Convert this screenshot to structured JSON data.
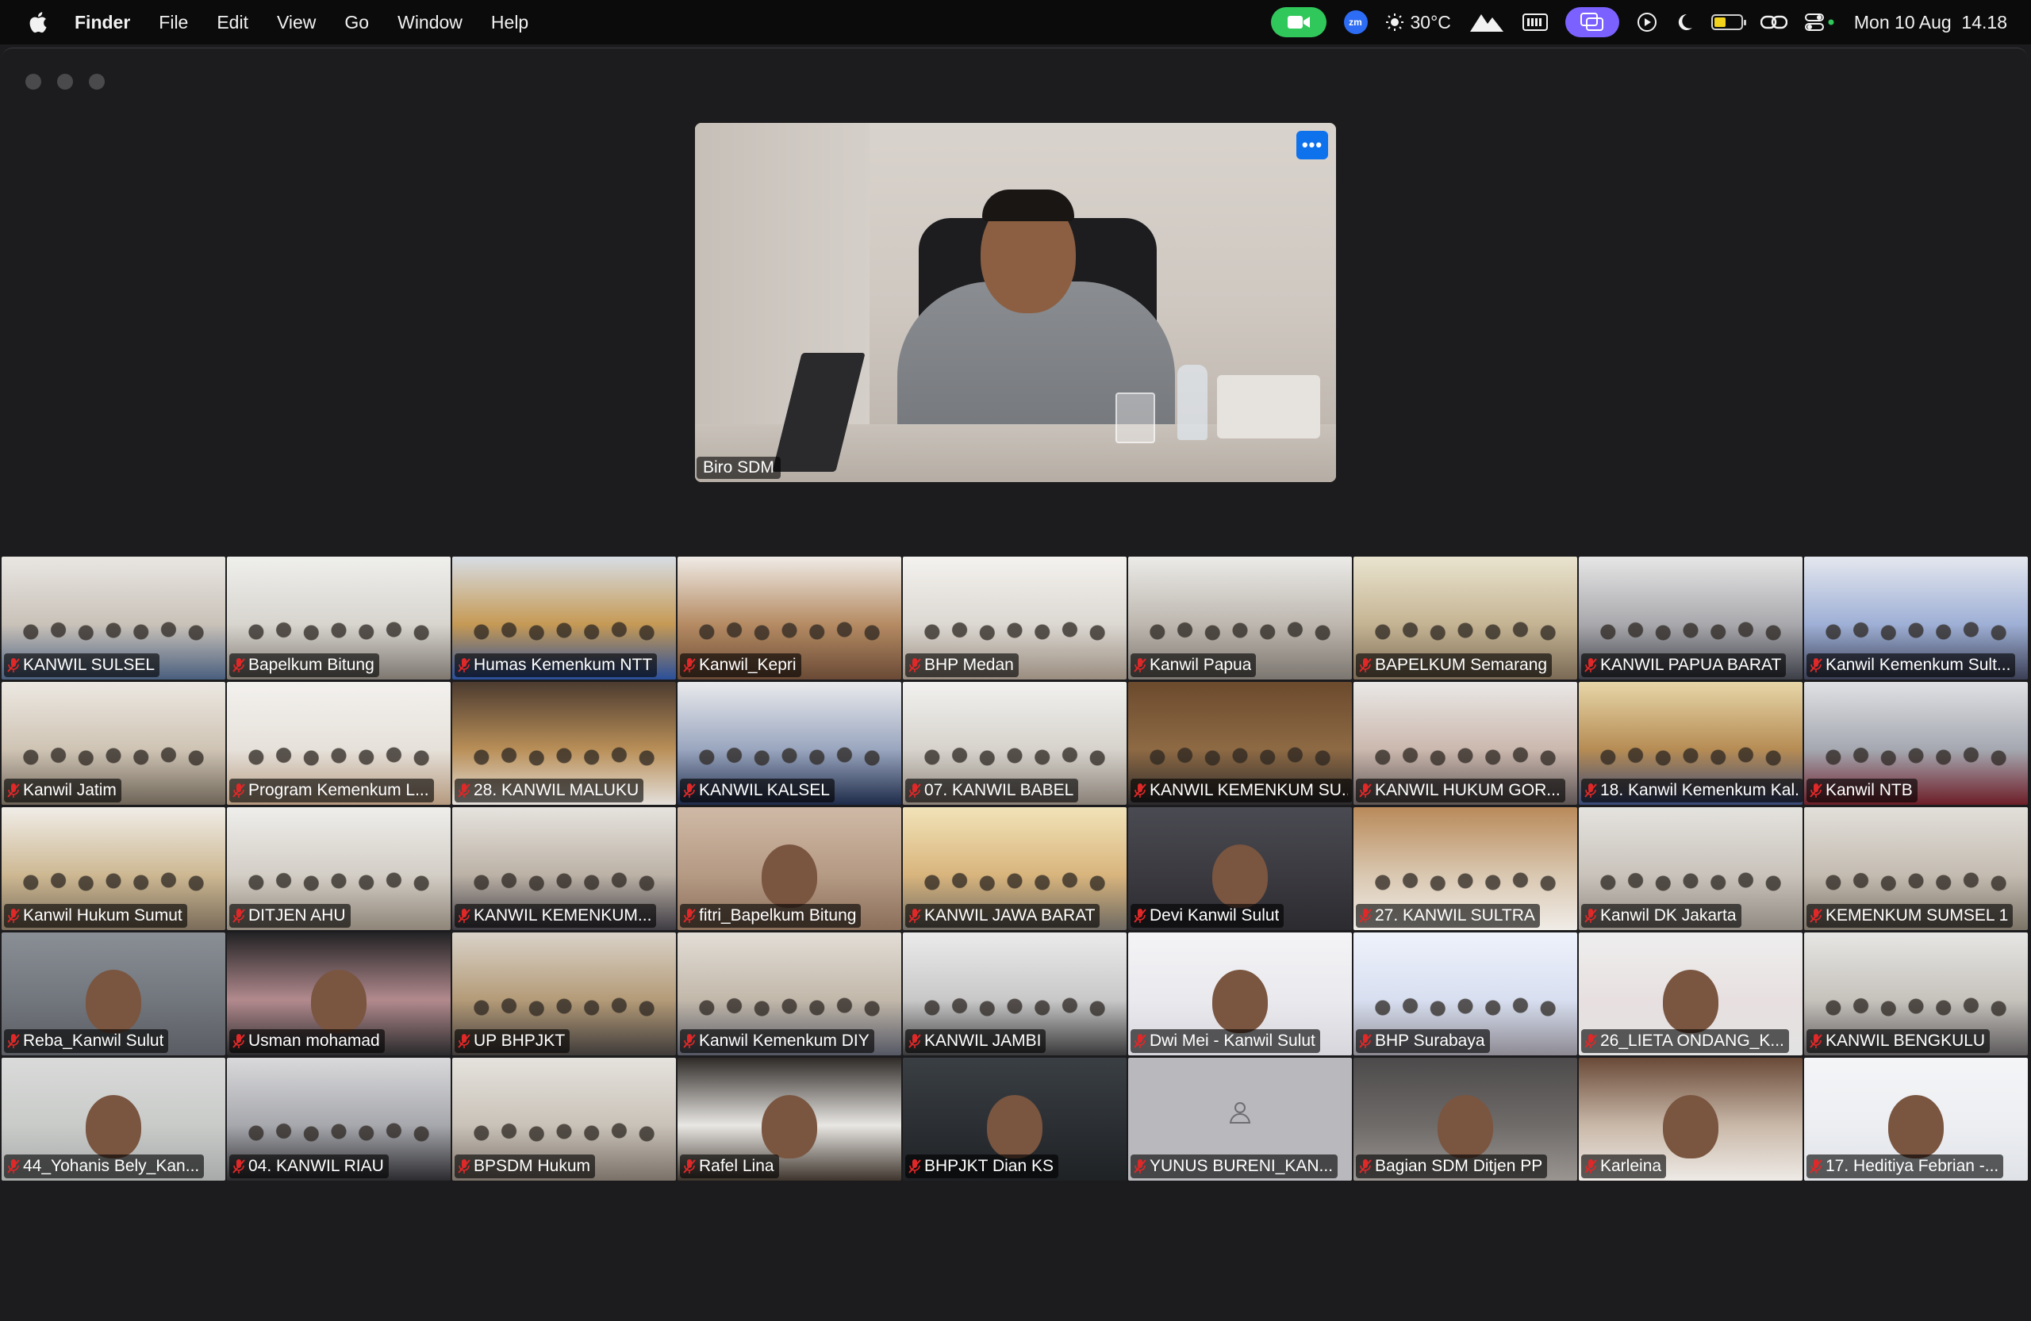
{
  "menubar": {
    "app": "Finder",
    "items": [
      "File",
      "Edit",
      "View",
      "Go",
      "Window",
      "Help"
    ],
    "weather": "30°C",
    "zoom_badge": "zm",
    "datetime": "Mon 10 Aug  14.18"
  },
  "speaker": {
    "name": "Biro SDM",
    "more_label": "•••"
  },
  "participants": [
    {
      "name": "KANWIL SULSEL",
      "kind": "room",
      "c": [
        "#e9e6e2",
        "#c9c2b9",
        "#4a5f7e"
      ]
    },
    {
      "name": "Bapelkum Bitung",
      "kind": "room",
      "c": [
        "#efefec",
        "#d8d5cf",
        "#7d7770"
      ]
    },
    {
      "name": "Humas Kemenkum NTT",
      "kind": "room",
      "c": [
        "#d7dde4",
        "#c69a55",
        "#2a4f9a"
      ]
    },
    {
      "name": "Kanwil_Kepri",
      "kind": "room",
      "c": [
        "#efebe6",
        "#b58b63",
        "#6a4a36"
      ]
    },
    {
      "name": "BHP Medan",
      "kind": "room",
      "c": [
        "#f4f2ef",
        "#dcd8d2",
        "#9a8d80"
      ]
    },
    {
      "name": "Kanwil Papua",
      "kind": "room",
      "c": [
        "#ecebe8",
        "#bdb7af",
        "#7c7670"
      ]
    },
    {
      "name": "BAPELKUM Semarang",
      "kind": "room",
      "c": [
        "#e9e4cf",
        "#c5b493",
        "#7a6a55"
      ]
    },
    {
      "name": "KANWIL PAPUA BARAT",
      "kind": "room",
      "c": [
        "#e6e6e6",
        "#a9a9ad",
        "#3d3f48"
      ]
    },
    {
      "name": "Kanwil Kemenkum Sult...",
      "kind": "room",
      "c": [
        "#e4e7ee",
        "#9fb0d6",
        "#3b3f55"
      ]
    },
    {
      "name": "Kanwil Jatim",
      "kind": "room",
      "c": [
        "#ece8e2",
        "#cfc4b4",
        "#6e6457"
      ]
    },
    {
      "name": "Program Kemenkum L...",
      "kind": "room",
      "c": [
        "#f3f1ee",
        "#e6e1da",
        "#b59a7f"
      ]
    },
    {
      "name": "28. KANWIL MALUKU",
      "kind": "room",
      "c": [
        "#4c3b2f",
        "#b98f58",
        "#e3dfda"
      ]
    },
    {
      "name": "KANWIL KALSEL",
      "kind": "room",
      "c": [
        "#e9eaec",
        "#9aa6bf",
        "#1f2c4a"
      ]
    },
    {
      "name": "07. KANWIL BABEL",
      "kind": "room",
      "c": [
        "#f1f1ef",
        "#d7d3cc",
        "#8a8178"
      ]
    },
    {
      "name": "KANWIL KEMENKUM SU...",
      "kind": "room",
      "c": [
        "#6b4a2d",
        "#8e6a44",
        "#2c2a2c"
      ]
    },
    {
      "name": "KANWIL HUKUM GOR...",
      "kind": "room",
      "c": [
        "#eae8e6",
        "#cbb8ae",
        "#5d5454"
      ]
    },
    {
      "name": "18. Kanwil Kemenkum Kal...",
      "kind": "room",
      "c": [
        "#e7d6a8",
        "#b68c54",
        "#3a4a78"
      ]
    },
    {
      "name": "Kanwil NTB",
      "kind": "room",
      "c": [
        "#e0e1e4",
        "#a5a8b1",
        "#6d1e28"
      ]
    },
    {
      "name": "Kanwil Hukum Sumut",
      "kind": "room",
      "c": [
        "#f0ede8",
        "#cdb892",
        "#7a6c5a"
      ]
    },
    {
      "name": "DITJEN AHU",
      "kind": "room",
      "c": [
        "#efeeeb",
        "#d3cec6",
        "#8f8579"
      ]
    },
    {
      "name": "KANWIL KEMENKUM...",
      "kind": "room",
      "c": [
        "#e6e3de",
        "#bcb2a6",
        "#3f3c44"
      ]
    },
    {
      "name": "fitri_Bapelkum Bitung",
      "kind": "portrait",
      "c": [
        "#cfb9a6",
        "#b59a84",
        "#8a6e5a"
      ]
    },
    {
      "name": "KANWIL JAWA BARAT",
      "kind": "room",
      "c": [
        "#f1e3b8",
        "#d9b57d",
        "#6f6a63"
      ]
    },
    {
      "name": "Devi Kanwil Sulut",
      "kind": "portrait",
      "c": [
        "#4a4a52",
        "#3b3a40",
        "#2c2b30"
      ]
    },
    {
      "name": "27. KANWIL SULTRA",
      "kind": "room",
      "c": [
        "#b98a5a",
        "#d9c7b0",
        "#f0ece7"
      ]
    },
    {
      "name": "Kanwil DK Jakarta",
      "kind": "room",
      "c": [
        "#e5e3df",
        "#c9c3bb",
        "#918a82"
      ]
    },
    {
      "name": "KEMENKUM SUMSEL 1",
      "kind": "room",
      "c": [
        "#e2dfda",
        "#c4bcb1",
        "#7c7367"
      ]
    },
    {
      "name": "Reba_Kanwil Sulut",
      "kind": "portrait",
      "c": [
        "#8a8e95",
        "#72767d",
        "#5a5d63"
      ]
    },
    {
      "name": "Usman mohamad",
      "kind": "portrait",
      "c": [
        "#222224",
        "#b28a8e",
        "#2a2a2c"
      ]
    },
    {
      "name": "UP BHPJKT",
      "kind": "room",
      "c": [
        "#d9d2c8",
        "#b49b78",
        "#3f3b3a"
      ]
    },
    {
      "name": "Kanwil Kemenkum DIY",
      "kind": "room",
      "c": [
        "#e2ddd6",
        "#c2b8aa",
        "#555865"
      ]
    },
    {
      "name": "KANWIL JAMBI",
      "kind": "room",
      "c": [
        "#ebebeb",
        "#c8c8c8",
        "#3a3a3c"
      ]
    },
    {
      "name": "Dwi Mei - Kanwil Sulut",
      "kind": "portrait",
      "c": [
        "#f4f4f6",
        "#e9e9ee",
        "#d6d6dc"
      ]
    },
    {
      "name": "BHP Surabaya",
      "kind": "room",
      "c": [
        "#eef2fb",
        "#d8dff0",
        "#8d8a93"
      ]
    },
    {
      "name": "26_LIETA ONDANG_K...",
      "kind": "portrait",
      "c": [
        "#eeeeee",
        "#e8e0e0",
        "#e2e2e2"
      ]
    },
    {
      "name": "KANWIL BENGKULU",
      "kind": "room",
      "c": [
        "#e6e6e4",
        "#c6c2bc",
        "#5e5b5d"
      ]
    },
    {
      "name": "44_Yohanis Bely_Kan...",
      "kind": "portrait",
      "c": [
        "#d9dad9",
        "#c9cbc9",
        "#a7aaa9"
      ]
    },
    {
      "name": "04. KANWIL RIAU",
      "kind": "room",
      "c": [
        "#d9d9db",
        "#a7a8ad",
        "#2c2c30"
      ]
    },
    {
      "name": "BPSDM Hukum",
      "kind": "room",
      "c": [
        "#e5e2dd",
        "#c9c2b8",
        "#7a7168"
      ]
    },
    {
      "name": "Rafel Lina",
      "kind": "portrait",
      "c": [
        "#2f2b28",
        "#e9e7e3",
        "#3e352d"
      ]
    },
    {
      "name": "BHPJKT Dian KS",
      "kind": "portrait",
      "c": [
        "#3a3f44",
        "#2b2f33",
        "#1f2225"
      ]
    },
    {
      "name": "YUNUS BURENI_KAN...",
      "kind": "avatar",
      "c": [
        "#b9b9bd",
        "#b9b9bd",
        "#b9b9bd"
      ]
    },
    {
      "name": "Bagian SDM Ditjen PP",
      "kind": "portrait",
      "c": [
        "#4d4a4b",
        "#6f6b69",
        "#9a9591"
      ]
    },
    {
      "name": "Karleina",
      "kind": "portrait",
      "c": [
        "#6a4a38",
        "#c9b8a8",
        "#eeeae6"
      ]
    },
    {
      "name": "17. Heditiya Febrian -...",
      "kind": "portrait",
      "c": [
        "#f4f5f7",
        "#eceef2",
        "#dfe2e7"
      ]
    }
  ]
}
